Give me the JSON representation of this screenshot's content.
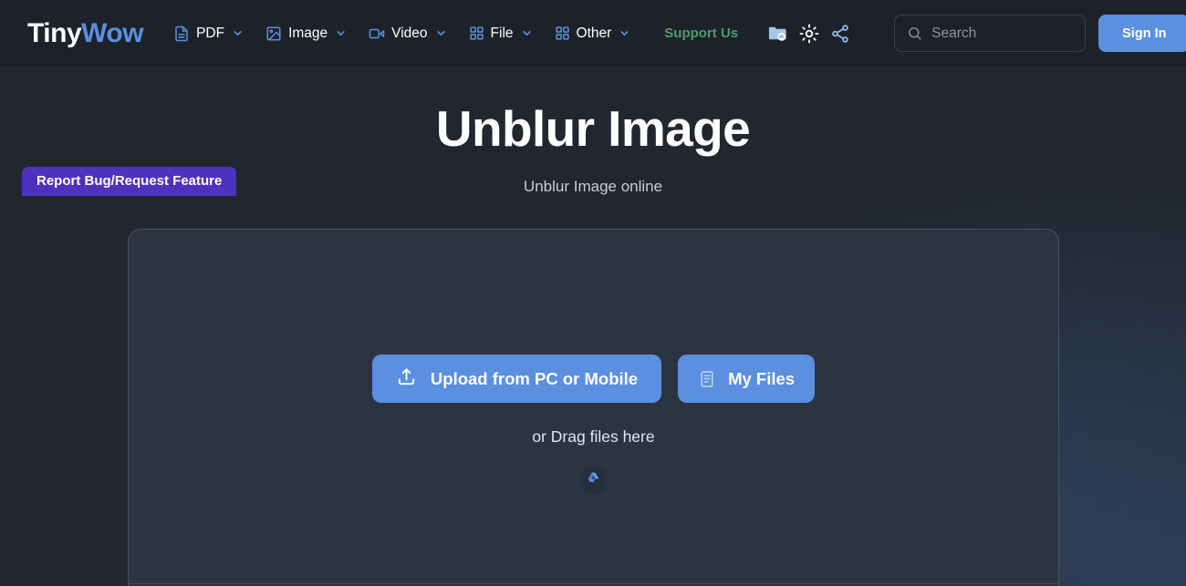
{
  "brand": {
    "name_part1": "Tiny",
    "name_part2": "Wow",
    "accent_blue": "#5b8fe0",
    "accent_green": "#4e9b6e",
    "accent_purple": "#4c32bd",
    "page_bg": "#22272f",
    "navbar_bg": "#1d222a",
    "dropzone_bg": "#2b3443"
  },
  "navbar": {
    "menus": [
      {
        "label": "PDF",
        "icon": "document-icon",
        "caret": "chevron-down-icon"
      },
      {
        "label": "Image",
        "icon": "image-icon",
        "caret": "chevron-down-icon"
      },
      {
        "label": "Video",
        "icon": "video-icon",
        "caret": "chevron-down-icon"
      },
      {
        "label": "File",
        "icon": "grid-icon",
        "caret": "chevron-down-icon"
      },
      {
        "label": "Other",
        "icon": "grid-icon",
        "caret": "chevron-down-icon"
      }
    ],
    "support_label": "Support Us",
    "utility_icons": [
      {
        "name": "cloud-folder-icon"
      },
      {
        "name": "sun-icon"
      },
      {
        "name": "share-icon"
      }
    ],
    "search": {
      "placeholder": "Search",
      "value": "",
      "icon": "search-icon"
    },
    "signin_label": "Sign In"
  },
  "hero": {
    "title": "Unblur Image",
    "subtitle": "Unblur Image online"
  },
  "dropzone": {
    "upload_button_label": "Upload from PC or Mobile",
    "upload_button_icon": "upload-icon",
    "myfiles_button_label": "My Files",
    "myfiles_button_icon": "file-list-icon",
    "drag_text": "or Drag files here",
    "drive_icon": "google-drive-icon"
  },
  "footer": {
    "bug_button_label": "Report Bug/Request Feature"
  }
}
